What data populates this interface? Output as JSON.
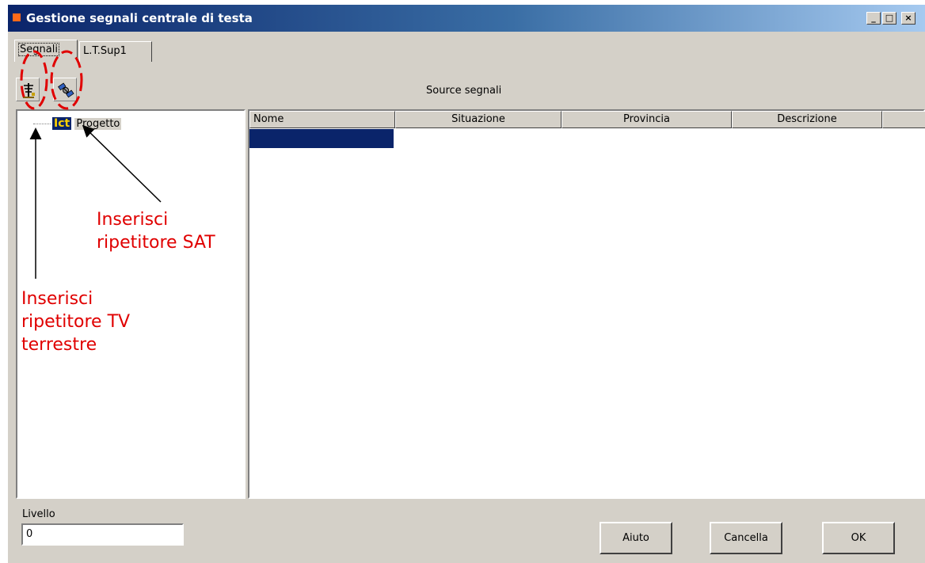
{
  "window": {
    "title": "Gestione segnali centrale di testa",
    "controls": {
      "minimize": "_",
      "maximize": "□",
      "close": "×"
    }
  },
  "tabs": [
    {
      "label": "Segnali",
      "active": true
    },
    {
      "label": "L.T.Sup1",
      "active": false
    }
  ],
  "toolbar": {
    "tools": [
      {
        "name": "terrestrial-repeater-tool",
        "icon": "antenna-icon"
      },
      {
        "name": "sat-repeater-tool",
        "icon": "satellite-icon"
      }
    ],
    "source_label": "Source segnali"
  },
  "tree": {
    "root": {
      "badge": "Ict",
      "label": "Progetto"
    }
  },
  "table": {
    "columns": [
      "Nome",
      "Situazione",
      "Provincia",
      "Descrizione"
    ],
    "rows": [
      {
        "selected": true,
        "cells": [
          "",
          "",
          "",
          ""
        ]
      }
    ]
  },
  "footer": {
    "level_label": "Livello",
    "level_value": "0",
    "buttons": {
      "help": "Aiuto",
      "cancel": "Cancella",
      "ok": "OK"
    }
  },
  "annotations": {
    "sat": [
      "Inserisci",
      "ripetitore SAT"
    ],
    "tv": [
      "Inserisci",
      "ripetitore TV",
      "terrestre"
    ],
    "color": "#e00000"
  },
  "colors": {
    "title_start": "#0a246a",
    "title_end": "#a6caf0",
    "face": "#d4d0c8",
    "selection": "#0a246a",
    "title_icon": "#ff6a1a"
  }
}
